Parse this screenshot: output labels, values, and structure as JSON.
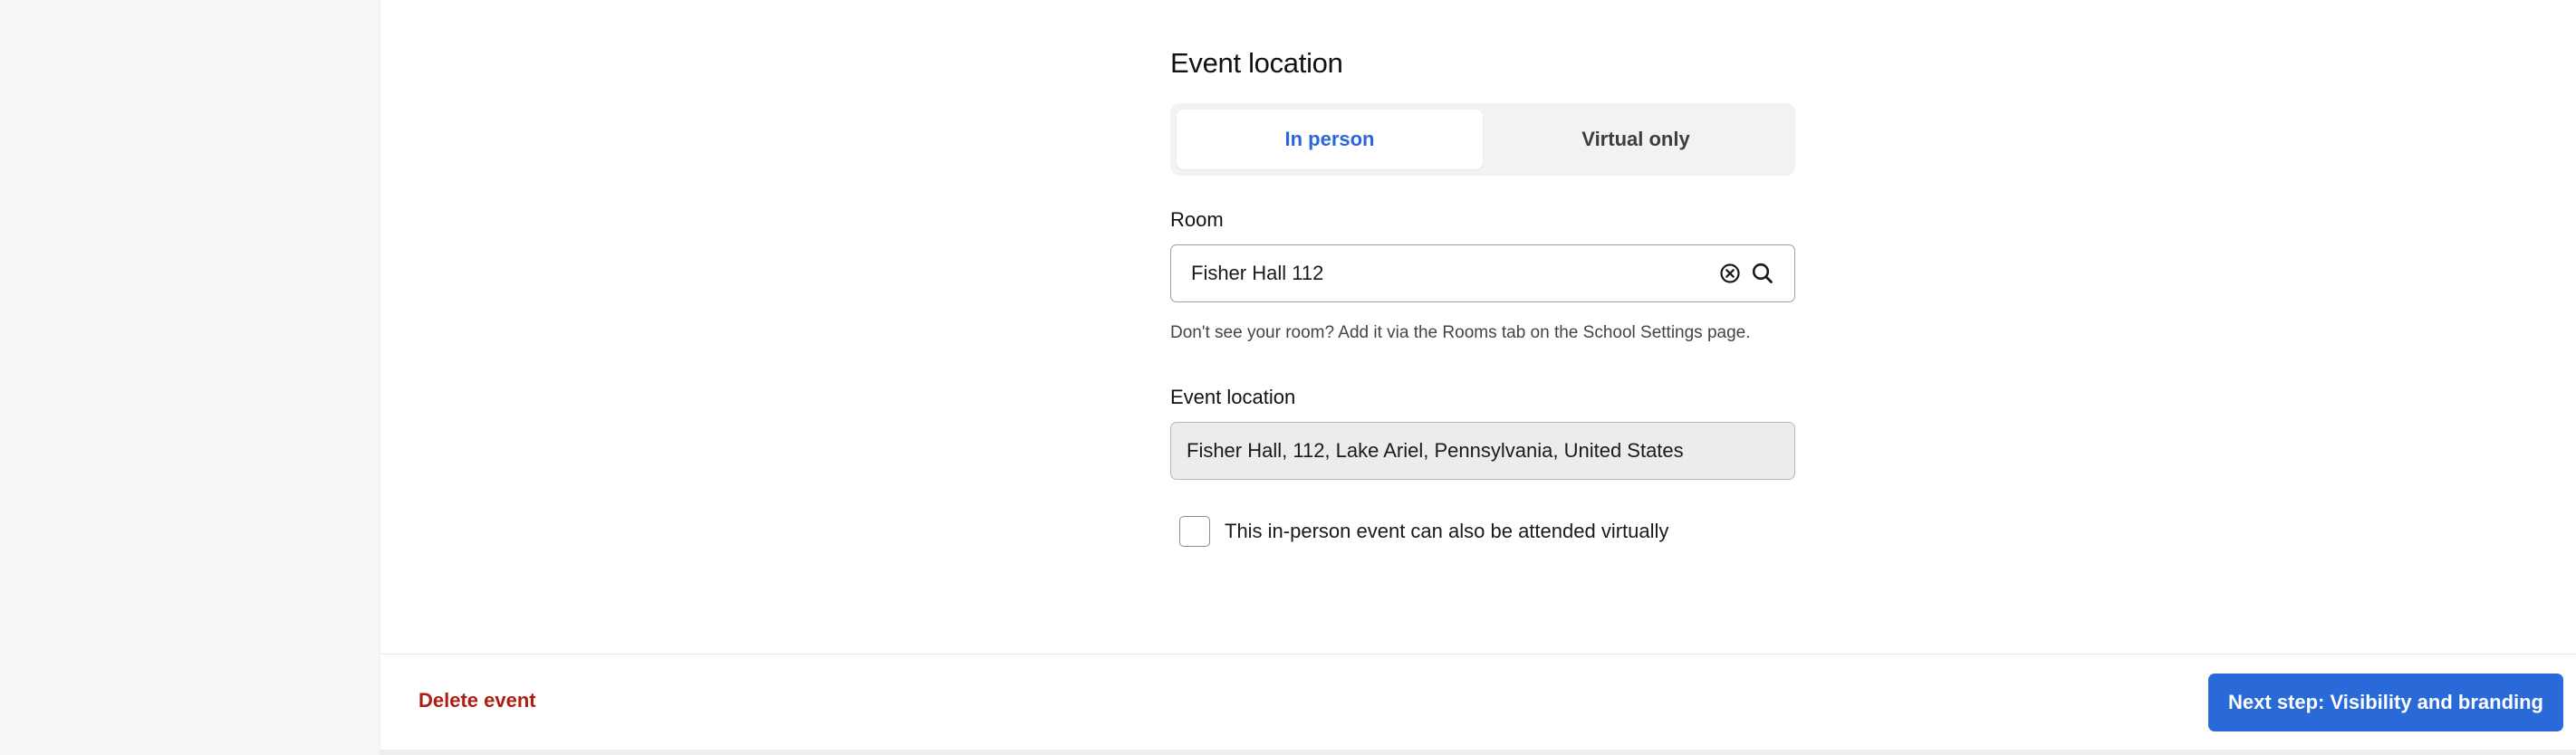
{
  "location": {
    "section_title": "Event location",
    "tabs": [
      {
        "label": "In person",
        "active": true
      },
      {
        "label": "Virtual only",
        "active": false
      }
    ],
    "room_label": "Room",
    "room_value": "Fisher Hall 112",
    "room_icons": [
      "clear-icon",
      "search-icon"
    ],
    "helper_text": "Don't see your room? Add it via the Rooms tab on the School Settings page.",
    "event_location_label": "Event location",
    "event_location_value": "Fisher Hall, 112, Lake Ariel, Pennsylvania, United States",
    "virtual_checkbox_label": "This in-person event can also be attended virtually",
    "virtual_checkbox_checked": false
  },
  "footer": {
    "delete_label": "Delete event",
    "next_label": "Next step: Visibility and branding"
  },
  "colors": {
    "accent": "#2a6ad8",
    "danger": "#b01e12",
    "sidebar_bg": "#f7f7f7"
  }
}
